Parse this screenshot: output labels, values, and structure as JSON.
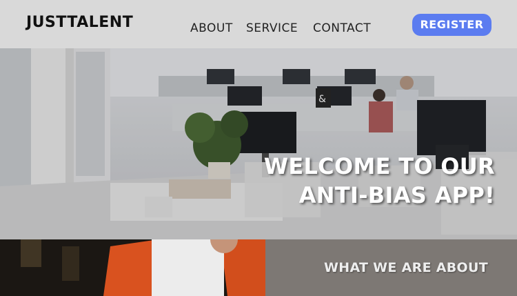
{
  "header": {
    "logo": "JUSTTALENT",
    "nav": [
      "ABOUT",
      "SERVICE",
      "CONTACT"
    ],
    "register_label": "REGISTER"
  },
  "hero": {
    "title_line1": "WELCOME TO OUR",
    "title_line2": "ANTI-BIAS APP!"
  },
  "about": {
    "title": "WHAT WE ARE ABOUT"
  },
  "colors": {
    "header_bg": "#d9d9d9",
    "accent": "#5b7cf0",
    "about_panel": "#7d7874"
  }
}
